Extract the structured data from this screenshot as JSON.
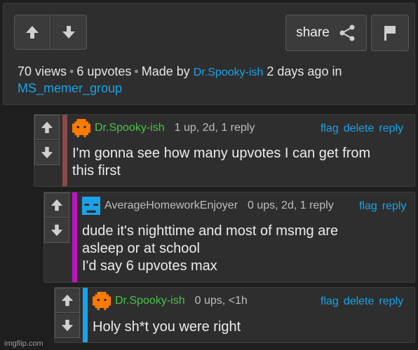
{
  "post": {
    "share_label": "share",
    "views": "70 views",
    "upvotes": "6 upvotes",
    "made_by_prefix": "Made by",
    "author": "Dr.Spooky-ish",
    "time_in": "2 days ago in",
    "stream": "MS_memer_group",
    "separator": "•"
  },
  "comments": [
    {
      "author": "Dr.Spooky-ish",
      "stats": "1 up, 2d, 1 reply",
      "actions": [
        "flag",
        "delete",
        "reply"
      ],
      "lines": [
        "I'm gonna see how many upvotes I can get from",
        "this first"
      ],
      "bar_color": "#8b4a4a",
      "avatar_color": "#ff7a00"
    },
    {
      "author": "AverageHomeworkEnjoyer",
      "stats": "0 ups, 2d, 1 reply",
      "actions": [
        "flag",
        "reply"
      ],
      "lines": [
        "dude it's nighttime and most of msmg are",
        "asleep or at school",
        "I'd say 6 upvotes max"
      ],
      "bar_color": "#c013c0",
      "avatar_color": "#1aa3e8"
    },
    {
      "author": "Dr.Spooky-ish",
      "stats": "0 ups, <1h",
      "actions": [
        "flag",
        "delete",
        "reply"
      ],
      "lines": [
        "Holy sh*t you were right"
      ],
      "bar_color": "#1aa3e8",
      "avatar_color": "#ff7a00"
    }
  ],
  "watermark": "imgflip.com",
  "icons": {
    "upvote": "arrow-up-icon",
    "downvote": "arrow-down-icon",
    "share": "share-icon",
    "flag": "flag-icon"
  }
}
